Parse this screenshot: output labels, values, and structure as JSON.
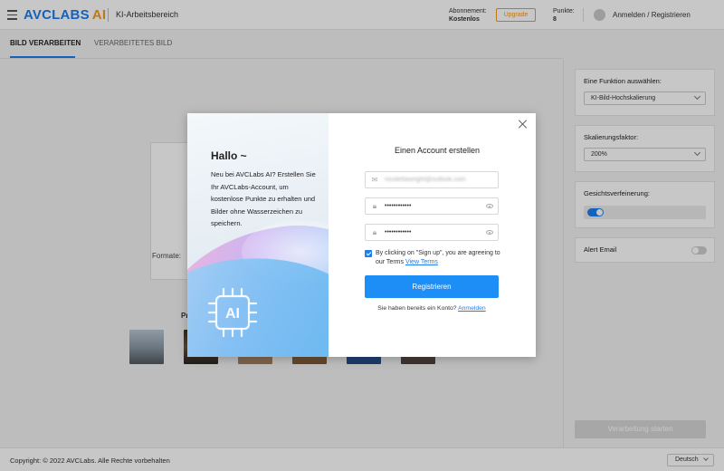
{
  "header": {
    "brand_main": "AVCLABS",
    "brand_ai": "AI",
    "workspace": "KI-Arbeitsbereich",
    "subscription_label": "Abonnement:",
    "subscription_value": "Kostenlos",
    "upgrade_label": "Upgrade",
    "points_label": "Punkte:",
    "points_value": "8",
    "login_label": "Anmelden / Registrieren"
  },
  "tabs": [
    {
      "label": "BILD VERARBEITEN",
      "active": true
    },
    {
      "label": "VERARBEITETES BILD",
      "active": false
    }
  ],
  "main": {
    "formats_label": "Formate:",
    "try_label": "Pr"
  },
  "sidebar": {
    "function_label": "Eine Funktion auswählen:",
    "function_value": "KI-Bild-Hochskalierung",
    "scale_label": "Skalierungsfaktor:",
    "scale_value": "200%",
    "face_label": "Gesichtsverfeinerung:",
    "face_enabled": true,
    "alert_label": "Alert Email",
    "alert_enabled": false,
    "start_label": "Verarbeitung starten"
  },
  "footer": {
    "copyright": "Copyright: © 2022 AVCLabs. Alle Rechte vorbehalten",
    "language": "Deutsch"
  },
  "modal": {
    "hello": "Hallo ~",
    "intro": "Neu bei AVCLabs AI? Erstellen Sie Ihr AVCLabs-Account, um kostenlose Punkte zu erhalten und Bilder ohne Wasserzeichen zu speichern.",
    "chip_text": "AI",
    "title": "Einen Account erstellen",
    "email_value": "nicolettawright@outlook.com",
    "password_value": "••••••••••••",
    "password_confirm_value": "••••••••••••",
    "terms_text": "By clicking on \"Sign up\", you are agreeing to our Terms",
    "terms_link": "View Terms",
    "agree_checked": true,
    "register_label": "Registrieren",
    "have_account": "Sie haben bereits ein Konto?",
    "login_link": "Anmelden"
  },
  "colors": {
    "accent": "#1c7ef2",
    "brand_ai": "#f39a1e",
    "register_button": "#1c8ef6"
  }
}
